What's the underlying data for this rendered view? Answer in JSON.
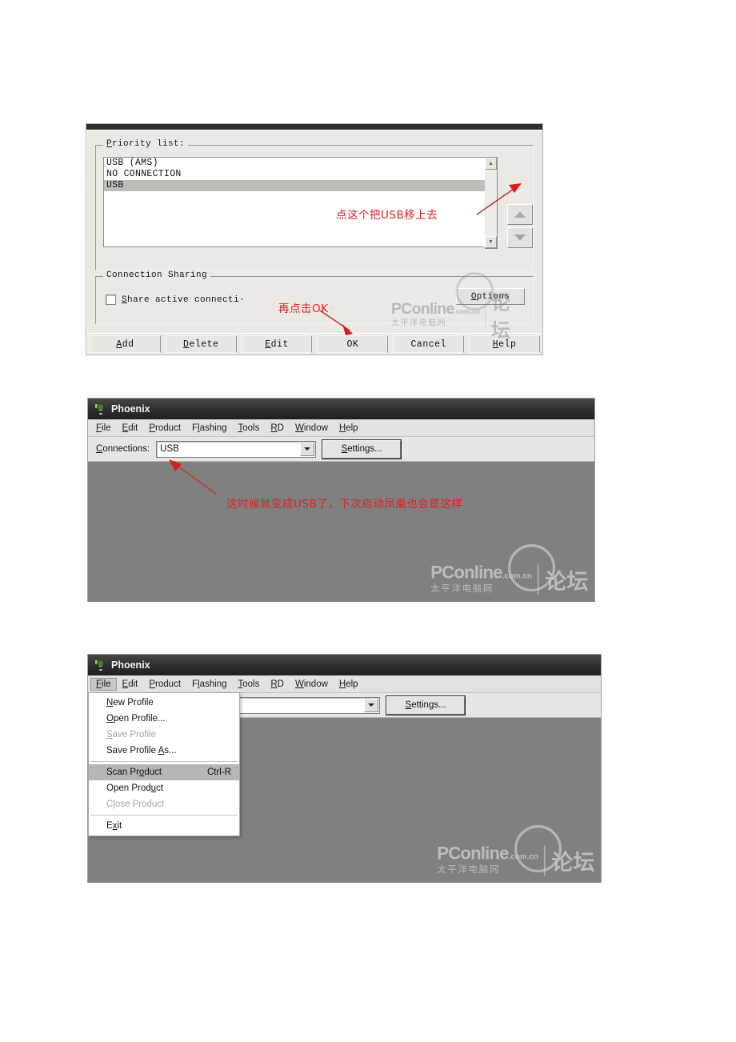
{
  "panel_connection_dialog": {
    "priority_group_label": "Priority list:",
    "list_items": [
      {
        "label": "USB (AMS)",
        "selected": false
      },
      {
        "label": "NO CONNECTION",
        "selected": false
      },
      {
        "label": "USB",
        "selected": true
      }
    ],
    "move_up_title": "Move up",
    "move_down_title": "Move down",
    "sharing_group_label": "Connection Sharing",
    "share_checkbox_label": "Share active connecti·",
    "options_button": "Options",
    "buttons": [
      "Add",
      "Delete",
      "Edit",
      "OK",
      "Cancel",
      "Help"
    ],
    "annotation_move_up": "点这个把USB移上去",
    "annotation_click_ok": "再点击OK"
  },
  "panel_phoenix_main": {
    "window_title": "Phoenix",
    "menu_items": [
      "File",
      "Edit",
      "Product",
      "Flashing",
      "Tools",
      "RD",
      "Window",
      "Help"
    ],
    "connections_label": "Connections:",
    "connections_value": "USB",
    "settings_button": "Settings...",
    "annotation": "这时候就变成USB了，下次启动凤凰也会是这样"
  },
  "panel_phoenix_file_menu": {
    "window_title": "Phoenix",
    "menu_items": [
      "File",
      "Edit",
      "Product",
      "Flashing",
      "Tools",
      "RD",
      "Window",
      "Help"
    ],
    "open_menu": "File",
    "settings_button": "Settings...",
    "file_menu": [
      {
        "label": "New Profile",
        "accel": "",
        "state": "normal"
      },
      {
        "label": "Open Profile...",
        "accel": "",
        "state": "normal"
      },
      {
        "label": "Save Profile",
        "accel": "",
        "state": "disabled"
      },
      {
        "label": "Save Profile As...",
        "accel": "",
        "state": "normal"
      },
      {
        "separator": true
      },
      {
        "label": "Scan Product",
        "accel": "Ctrl-R",
        "state": "highlighted"
      },
      {
        "label": "Open Product",
        "accel": "",
        "state": "normal"
      },
      {
        "label": "Close Product",
        "accel": "",
        "state": "disabled"
      },
      {
        "separator": true
      },
      {
        "label": "Exit",
        "accel": "",
        "state": "normal"
      }
    ]
  },
  "watermark": {
    "brand": "PConline",
    "domain": ".com.cn",
    "chinese_name": "太平洋电脑网",
    "forum": "论坛"
  },
  "colors": {
    "annotation_red": "#e02020",
    "dialog_face": "#ece9e4",
    "window_client": "#808080",
    "titlebar_dark": "#2e2e2e",
    "menu_highlight": "#b6b6b6"
  }
}
